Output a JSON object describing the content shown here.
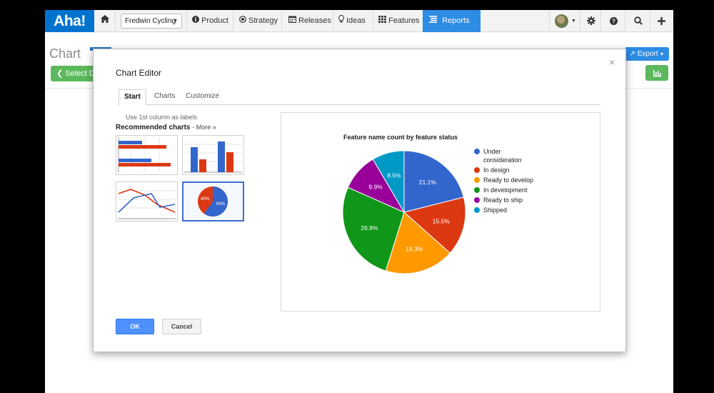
{
  "app": {
    "logo": "Aha!",
    "product_select": "Fredwin Cycling",
    "nav": {
      "product": "Product",
      "strategy": "Strategy",
      "releases": "Releases",
      "ideas": "Ideas",
      "features": "Features",
      "reports": "Reports"
    },
    "icons": {
      "home": "home-icon",
      "settings": "gear-icon",
      "help": "help-icon",
      "search": "search-icon",
      "add": "plus-icon"
    }
  },
  "page": {
    "title": "Chart",
    "select_button": "Select D",
    "export_button": "Export"
  },
  "modal": {
    "title": "Chart Editor",
    "close": "×",
    "tabs": [
      "Start",
      "Charts",
      "Customize"
    ],
    "active_tab": "Start",
    "use_first_column": "Use 1st column as labels",
    "recommended_label": "Recommended charts",
    "more_link": "- More »",
    "thumbnail_pie_labels": [
      "40%",
      "60%"
    ],
    "ok": "OK",
    "cancel": "Cancel"
  },
  "chart_data": {
    "type": "pie",
    "title": "Feature name count by feature status",
    "legend_position": "right",
    "categories": [
      "Under consideration",
      "In design",
      "Ready to develop",
      "In development",
      "Ready to ship",
      "Shipped"
    ],
    "legend_lines": [
      [
        "Under",
        "consideration"
      ],
      [
        "In design"
      ],
      [
        "Ready to develop"
      ],
      [
        "In development"
      ],
      [
        "Ready to ship"
      ],
      [
        "Shipped"
      ]
    ],
    "values": [
      21.1,
      15.5,
      18.3,
      26.8,
      9.9,
      8.5
    ],
    "labels": [
      "21.1%",
      "15.5%",
      "18.3%",
      "26.8%",
      "9.9%",
      "8.5%"
    ],
    "colors": [
      "#3366cc",
      "#dc3912",
      "#ff9900",
      "#109618",
      "#990099",
      "#0099c6"
    ]
  }
}
